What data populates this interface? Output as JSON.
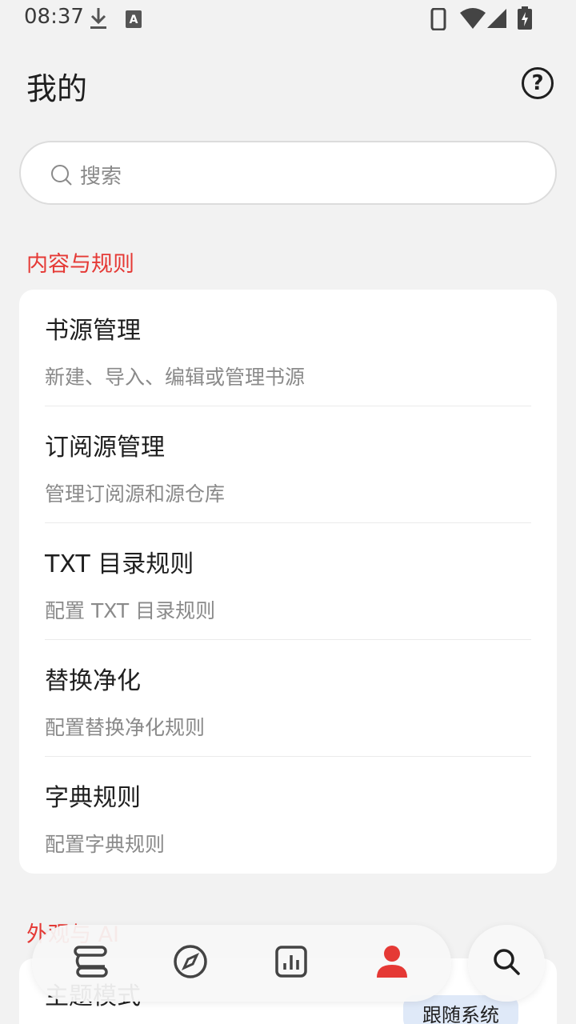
{
  "status_bar": {
    "time": "08:37"
  },
  "header": {
    "title": "我的"
  },
  "search": {
    "placeholder": "搜索"
  },
  "sections": [
    {
      "title": "内容与规则",
      "items": [
        {
          "title": "书源管理",
          "subtitle": "新建、导入、编辑或管理书源"
        },
        {
          "title": "订阅源管理",
          "subtitle": "管理订阅源和源仓库"
        },
        {
          "title": "TXT 目录规则",
          "subtitle": "配置 TXT 目录规则"
        },
        {
          "title": "替换净化",
          "subtitle": "配置替换净化规则"
        },
        {
          "title": "字典规则",
          "subtitle": "配置字典规则"
        }
      ]
    },
    {
      "title": "外观与 AI",
      "items": [
        {
          "title": "主题模式",
          "value": "跟随系统"
        }
      ]
    }
  ],
  "bottom_nav": {
    "items": [
      "bookshelf-icon",
      "compass-icon",
      "chart-icon",
      "person-icon"
    ],
    "active_index": 3,
    "search": "search-icon"
  },
  "colors": {
    "accent": "#e53935",
    "chip_bg": "#dfe9f8",
    "background": "#f2f2f2"
  }
}
